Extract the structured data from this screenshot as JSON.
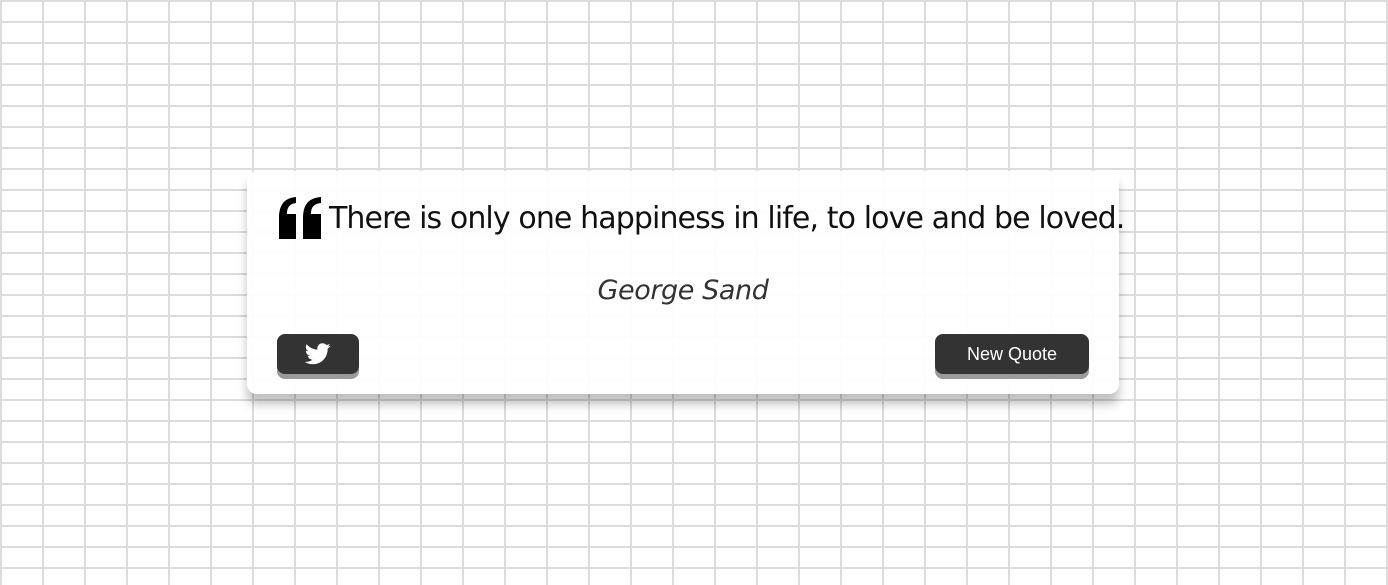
{
  "quote": {
    "text": "There is only one happiness in life, to love and be loved.",
    "author": "George Sand",
    "quote_icon": "quote-left-icon"
  },
  "actions": {
    "tweet_icon": "twitter-icon",
    "new_quote_label": "New Quote"
  },
  "colors": {
    "button_bg": "#333333",
    "button_text": "#ffffff",
    "quote_text": "#111111",
    "author_text": "#333333",
    "card_bg": "#ffffff",
    "brick_lines": "#dcdcdc"
  }
}
